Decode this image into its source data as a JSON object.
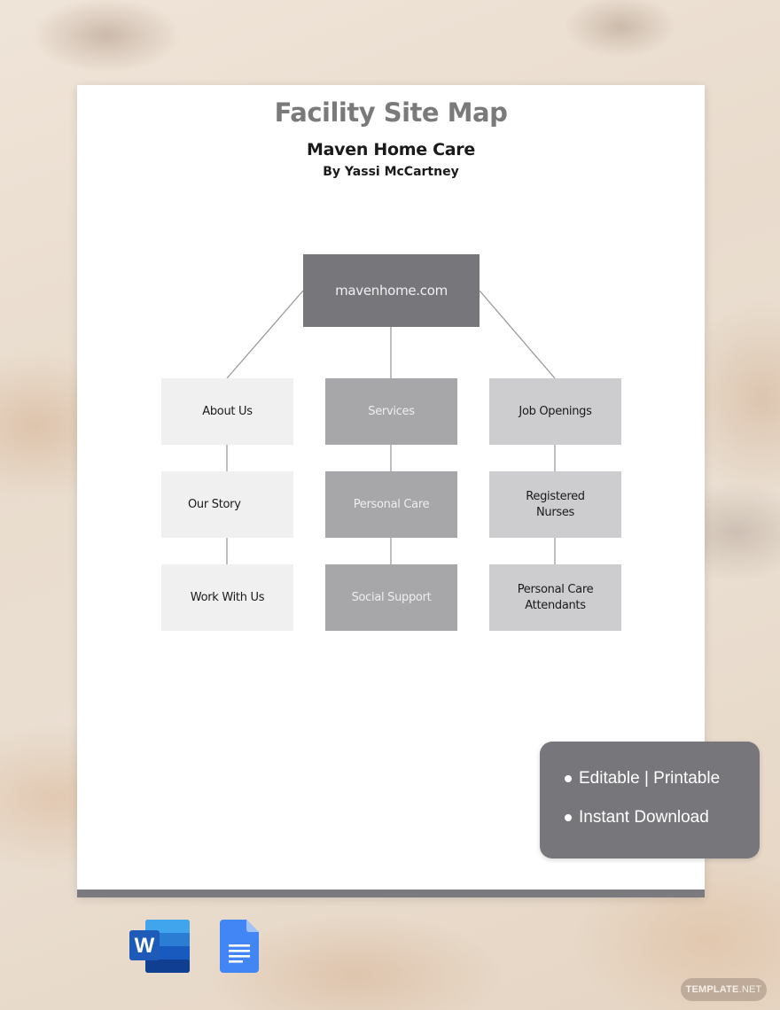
{
  "document": {
    "title": "Facility Site Map",
    "subtitle": "Maven Home Care",
    "author": "By Yassi McCartney"
  },
  "sitemap": {
    "root": "mavenhome.com",
    "columns": [
      {
        "items": [
          "About Us",
          "Our Story",
          "Work With Us"
        ],
        "style": "light"
      },
      {
        "items": [
          "Services",
          "Personal Care",
          "Social Support"
        ],
        "style": "mid"
      },
      {
        "items": [
          "Job Openings",
          "Registered Nurses",
          "Personal Care Attendants"
        ],
        "style": "pale"
      }
    ],
    "colors": {
      "root": "#77767b",
      "light": "#f0f0f0",
      "mid": "#a7a7aa",
      "pale": "#cdcdd0",
      "connector": "#9a9a9a"
    }
  },
  "features": {
    "items": [
      "Editable | Printable",
      "Instant Download"
    ]
  },
  "formats": {
    "icons": [
      "word-icon",
      "google-docs-icon"
    ]
  },
  "watermark": {
    "brand": "TEMPLATE",
    "suffix": ".NET"
  }
}
